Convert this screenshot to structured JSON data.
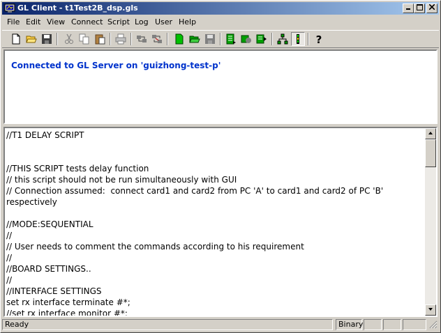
{
  "window": {
    "title": "GL Client - t1Test2B_dsp.gls"
  },
  "menu": [
    "File",
    "Edit",
    "View",
    "Connect",
    "Script",
    "Log",
    "User",
    "Help"
  ],
  "toolbar": [
    "new-file-icon",
    "open-folder-icon",
    "save-icon",
    "cut-icon",
    "copy-icon",
    "paste-icon",
    "print-icon",
    "connect-icon",
    "disconnect-icon",
    "new-script-icon",
    "open-script-icon",
    "save-script-icon",
    "run-script-icon",
    "stop-script-icon",
    "step-script-icon",
    "network-icon",
    "status-icon",
    "help-icon"
  ],
  "output": {
    "message": "Connected to GL Server on 'guizhong-test-p'"
  },
  "script": {
    "lines": [
      "//T1 DELAY SCRIPT",
      "",
      "",
      "//THIS SCRIPT tests delay function",
      "// this script should not be run simultaneously with GUI",
      "// Connection assumed:  connect card1 and card2 from PC 'A' to card1 and card2 of PC 'B' respectively",
      "",
      "//MODE:SEQUENTIAL",
      "//",
      "// User needs to comment the commands according to his requirement",
      "//",
      "//BOARD SETTINGS..",
      "//",
      "//INTERFACE SETTINGS",
      "set rx interface terminate #*;",
      "//set rx interface monitor #*;"
    ]
  },
  "status": {
    "text": "Ready",
    "mode": "Binary"
  }
}
